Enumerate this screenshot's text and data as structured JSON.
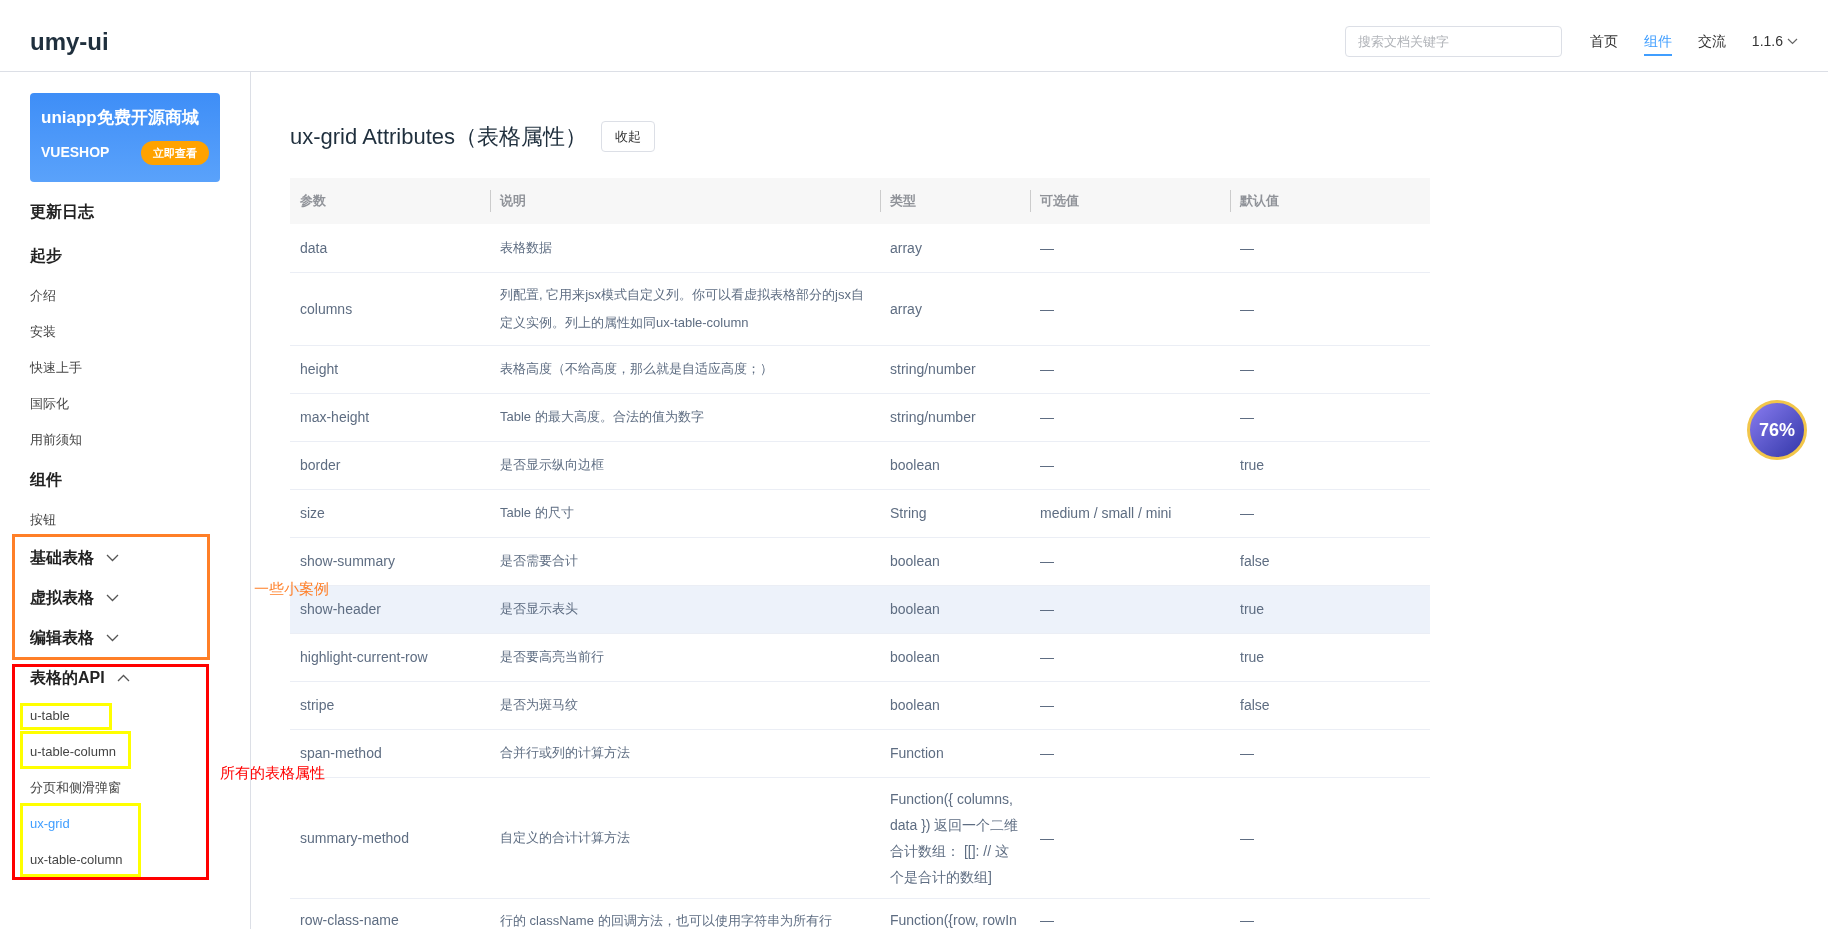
{
  "header": {
    "logo": "umy-ui",
    "search": {
      "placeholder": "搜索文档关键字"
    },
    "nav": [
      {
        "label": "首页",
        "selected": false
      },
      {
        "label": "组件",
        "selected": true
      },
      {
        "label": "交流",
        "selected": false
      }
    ],
    "version": "1.1.6"
  },
  "banner": {
    "title": "uniapp免费开源商城",
    "brand": "VUESHOP",
    "button": "立即查看"
  },
  "sidebar": {
    "items": [
      {
        "kind": "heading",
        "label": "更新日志"
      },
      {
        "kind": "heading",
        "label": "起步"
      },
      {
        "kind": "link",
        "label": "介绍",
        "selected": false
      },
      {
        "kind": "link",
        "label": "安装",
        "selected": false
      },
      {
        "kind": "link",
        "label": "快速上手",
        "selected": false
      },
      {
        "kind": "link",
        "label": "国际化",
        "selected": false
      },
      {
        "kind": "link",
        "label": "用前须知",
        "selected": false
      },
      {
        "kind": "heading",
        "label": "组件"
      },
      {
        "kind": "link",
        "label": "按钮",
        "selected": false
      },
      {
        "kind": "group",
        "label": "基础表格",
        "expanded": false
      },
      {
        "kind": "group",
        "label": "虚拟表格",
        "expanded": false
      },
      {
        "kind": "group",
        "label": "编辑表格",
        "expanded": false
      },
      {
        "kind": "group",
        "label": "表格的API",
        "expanded": true,
        "children": [
          {
            "label": "u-table",
            "selected": false
          },
          {
            "label": "u-table-column",
            "selected": false
          },
          {
            "label": "分页和侧滑弹窗",
            "selected": false
          },
          {
            "label": "ux-grid",
            "selected": true
          },
          {
            "label": "ux-table-column",
            "selected": false
          }
        ]
      }
    ]
  },
  "annotations": [
    {
      "label": "一些小案例",
      "color": "#ff7f27"
    },
    {
      "label": "所有的表格属性",
      "color": "#ff0000"
    }
  ],
  "main": {
    "title": "ux-grid Attributes（表格属性）",
    "collapse_button": "收起",
    "table": {
      "columns": [
        "参数",
        "说明",
        "类型",
        "可选值",
        "默认值"
      ],
      "rows": [
        {
          "cells": [
            "data",
            "表格数据",
            "array",
            "—",
            "—"
          ],
          "highlighted": false
        },
        {
          "cells": [
            "columns",
            "列配置, 它用来jsx模式自定义列。你可以看虚拟表格部分的jsx自定义实例。列上的属性如同ux-table-column",
            "array",
            "—",
            "—"
          ],
          "highlighted": false
        },
        {
          "cells": [
            "height",
            "表格高度（不给高度，那么就是自适应高度；）",
            "string/number",
            "—",
            "—"
          ],
          "highlighted": false
        },
        {
          "cells": [
            "max-height",
            "Table 的最大高度。合法的值为数字",
            "string/number",
            "—",
            "—"
          ],
          "highlighted": false
        },
        {
          "cells": [
            "border",
            "是否显示纵向边框",
            "boolean",
            "—",
            "true"
          ],
          "highlighted": false
        },
        {
          "cells": [
            "size",
            "Table 的尺寸",
            "String",
            "medium / small / mini",
            "—"
          ],
          "highlighted": false
        },
        {
          "cells": [
            "show-summary",
            "是否需要合计",
            "boolean",
            "—",
            "false"
          ],
          "highlighted": false
        },
        {
          "cells": [
            "show-header",
            "是否显示表头",
            "boolean",
            "—",
            "true"
          ],
          "highlighted": true
        },
        {
          "cells": [
            "highlight-current-row",
            "是否要高亮当前行",
            "boolean",
            "—",
            "true"
          ],
          "highlighted": false
        },
        {
          "cells": [
            "stripe",
            "是否为斑马纹",
            "boolean",
            "—",
            "false"
          ],
          "highlighted": false
        },
        {
          "cells": [
            "span-method",
            "合并行或列的计算方法",
            "Function",
            "—",
            "—"
          ],
          "highlighted": false
        },
        {
          "cells": [
            "summary-method",
            "自定义的合计计算方法",
            "Function({ columns, data }) 返回一个二维合计数组： [[]: // 这个是合计的数组]",
            "—",
            "—"
          ],
          "highlighted": false
        },
        {
          "cells": [
            "row-class-name",
            "行的 className 的回调方法，也可以使用字符串为所有行",
            "Function({row, rowIn",
            "—",
            "—"
          ],
          "highlighted": false
        }
      ]
    }
  },
  "float_widget": {
    "reading": "76%"
  }
}
